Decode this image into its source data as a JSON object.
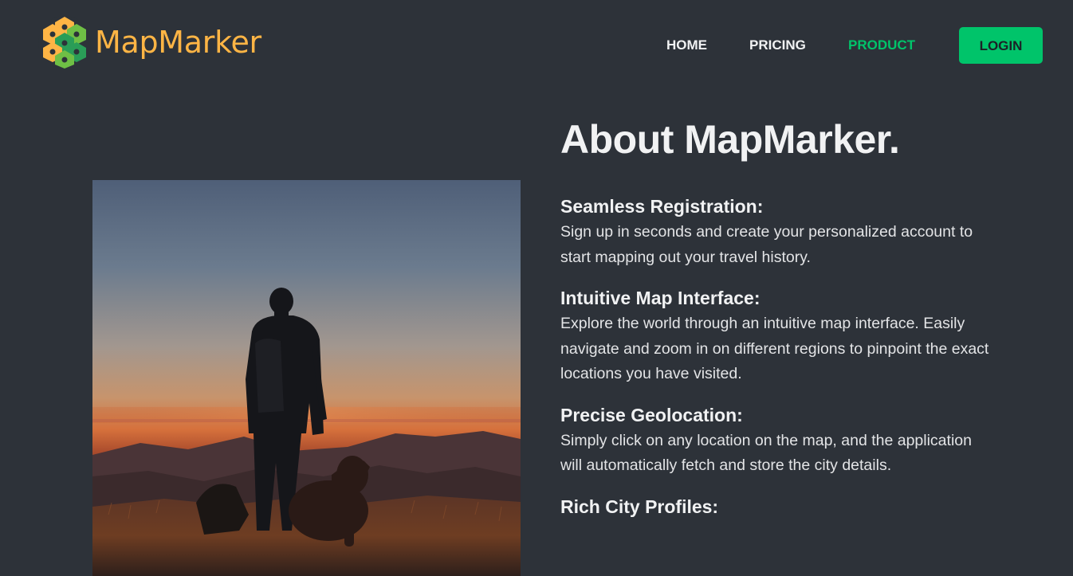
{
  "header": {
    "brand": "MapMarker",
    "nav": {
      "home": "HOME",
      "pricing": "PRICING",
      "product": "PRODUCT",
      "login": "LOGIN"
    }
  },
  "colors": {
    "background": "#2d3239",
    "accent": "#00c46a",
    "brand": "#ffb545",
    "text": "#f1f2f3"
  },
  "main": {
    "title": "About MapMarker.",
    "features": [
      {
        "title": "Seamless Registration:",
        "text": "Sign up in seconds and create your personalized account to start mapping out your travel history."
      },
      {
        "title": "Intuitive Map Interface:",
        "text": "Explore the world through an intuitive map interface. Easily navigate and zoom in on different regions to pinpoint the exact locations you have visited."
      },
      {
        "title": "Precise Geolocation:",
        "text": "Simply click on any location on the map, and the application will automatically fetch and store the city details."
      },
      {
        "title": "Rich City Profiles:",
        "text": ""
      }
    ]
  }
}
